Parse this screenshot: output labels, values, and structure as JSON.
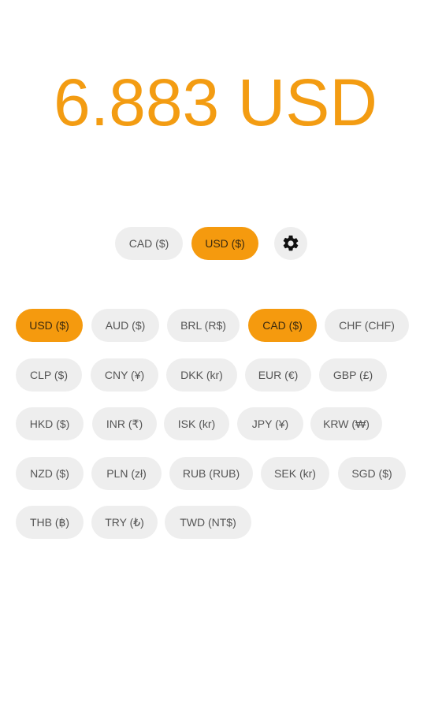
{
  "result": {
    "text": "6.883 USD"
  },
  "pair": {
    "from": "CAD ($)",
    "to": "USD ($)"
  },
  "settings": {
    "icon": "gear-icon"
  },
  "currencies": [
    {
      "label": "USD ($)",
      "selected": true
    },
    {
      "label": "AUD ($)",
      "selected": false
    },
    {
      "label": "BRL (R$)",
      "selected": false
    },
    {
      "label": "CAD ($)",
      "selected": true
    },
    {
      "label": "CHF (CHF)",
      "selected": false
    },
    {
      "label": "CLP ($)",
      "selected": false
    },
    {
      "label": "CNY (¥)",
      "selected": false
    },
    {
      "label": "DKK (kr)",
      "selected": false
    },
    {
      "label": "EUR (€)",
      "selected": false
    },
    {
      "label": "GBP (£)",
      "selected": false
    },
    {
      "label": "HKD ($)",
      "selected": false
    },
    {
      "label": "INR (₹)",
      "selected": false
    },
    {
      "label": "ISK (kr)",
      "selected": false
    },
    {
      "label": "JPY (¥)",
      "selected": false
    },
    {
      "label": "KRW (₩)",
      "selected": false
    },
    {
      "label": "NZD ($)",
      "selected": false
    },
    {
      "label": "PLN (zł)",
      "selected": false
    },
    {
      "label": "RUB (RUB)",
      "selected": false
    },
    {
      "label": "SEK (kr)",
      "selected": false
    },
    {
      "label": "SGD ($)",
      "selected": false
    },
    {
      "label": "THB (฿)",
      "selected": false
    },
    {
      "label": "TRY (₺)",
      "selected": false
    },
    {
      "label": "TWD (NT$)",
      "selected": false
    }
  ],
  "colors": {
    "accent": "#F59A0E",
    "result_text": "#F39C12",
    "chip_bg": "#EEEEEE",
    "chip_text": "#555555"
  }
}
